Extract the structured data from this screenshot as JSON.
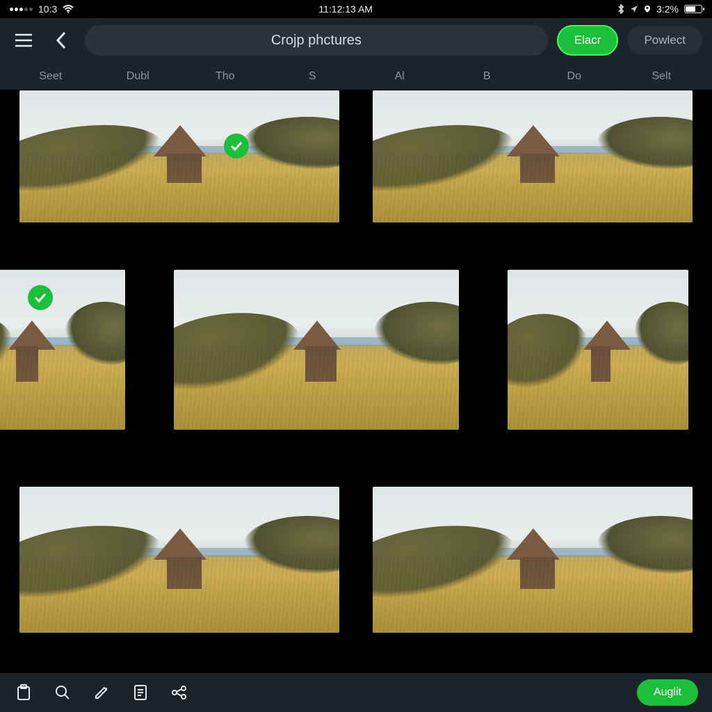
{
  "status": {
    "left_time": "10:3",
    "center_time": "11:12:13 AM",
    "right_pct": "3:2%"
  },
  "header": {
    "title": "Crojp phctures",
    "primary_btn": "Elacr",
    "secondary_btn": "Powlect"
  },
  "tabs": {
    "items": [
      "Seet",
      "Dubl",
      "Tho",
      "S",
      "Al",
      "B",
      "Do",
      "Selt"
    ]
  },
  "toolbar": {
    "apply_label": "Auglit"
  },
  "colors": {
    "accent": "#1bbf3a",
    "bg_header": "#1b232b",
    "bg_pill": "#2a323a"
  },
  "gallery": {
    "rows": [
      {
        "items": [
          {
            "selected": true
          },
          {
            "selected": false
          }
        ]
      },
      {
        "items": [
          {
            "selected": true
          },
          {
            "selected": false
          },
          {
            "selected": false
          }
        ]
      },
      {
        "items": [
          {
            "selected": false
          },
          {
            "selected": false
          }
        ]
      }
    ]
  }
}
